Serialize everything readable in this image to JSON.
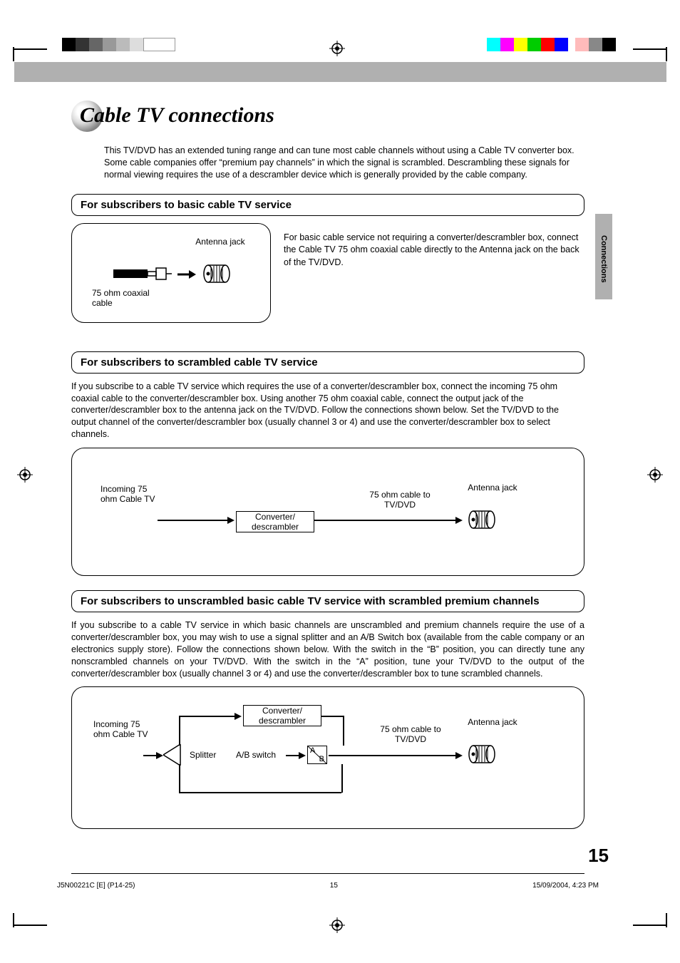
{
  "sideTab": "Connections",
  "title": "Cable TV connections",
  "intro": "This TV/DVD has an extended tuning range and can tune most cable channels without using a Cable TV converter box. Some cable companies offer “premium pay channels” in which the signal is scrambled. Descrambling these signals for normal viewing requires the use of a descrambler device which is generally provided by the cable company.",
  "sec1": {
    "heading": "For subscribers to basic cable TV service",
    "antennaLabel": "Antenna jack",
    "coaxLabel": "75 ohm coaxial cable",
    "body": "For basic cable service not requiring a converter/descrambler box, connect the Cable TV 75 ohm coaxial cable directly to the Antenna jack on the back of the TV/DVD."
  },
  "sec2": {
    "heading": "For subscribers to scrambled cable TV service",
    "body": "If you subscribe to a cable TV service which requires the use of a converter/descrambler box, connect the incoming 75 ohm coaxial cable to the converter/descrambler box. Using another 75 ohm coaxial cable, connect the output jack of the converter/descrambler box to the antenna jack on the TV/DVD. Follow the connections shown below. Set the TV/DVD to the output channel of the converter/descrambler box (usually channel 3 or 4) and use the converter/descrambler box to select channels.",
    "incomingLabel": "Incoming 75 ohm Cable TV",
    "converterLabel": "Converter/ descrambler",
    "toTvLabel": "75 ohm cable to TV/DVD",
    "antennaLabel": "Antenna jack"
  },
  "sec3": {
    "heading": "For subscribers to unscrambled basic cable TV service with scrambled premium channels",
    "body": "If you subscribe to a cable TV service in which basic channels are unscrambled and premium channels require the use of a converter/descrambler box, you may wish to use a signal splitter and an A/B Switch box (available from the cable company or an electronics supply store). Follow the connections shown below. With the switch in the “B” position, you can directly tune any nonscrambled channels on your TV/DVD. With the switch in the “A” position, tune your TV/DVD to the output of the converter/descrambler box (usually channel 3 or 4) and use the converter/descrambler box to tune scrambled channels.",
    "incomingLabel": "Incoming 75 ohm Cable TV",
    "converterLabel": "Converter/ descrambler",
    "splitterLabel": "Splitter",
    "abLabel": "A/B switch",
    "a": "A",
    "b": "B",
    "toTvLabel": "75 ohm cable to TV/DVD",
    "antennaLabel": "Antenna jack"
  },
  "pageNumber": "15",
  "footer": {
    "left": "J5N00221C [E] (P14-25)",
    "center": "15",
    "right": "15/09/2004, 4:23 PM"
  }
}
